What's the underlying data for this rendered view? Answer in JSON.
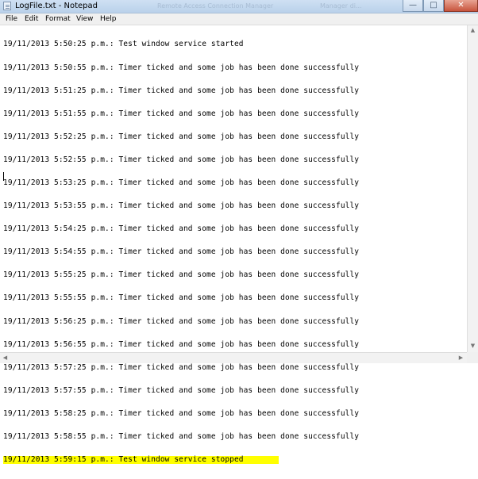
{
  "window": {
    "title": "LogFile.txt - Notepad",
    "background_titles": [
      "Remote Access Connection Manager",
      "Manager di..."
    ],
    "controls": {
      "minimize": "—",
      "maximize": "□",
      "close": "✕"
    }
  },
  "menu": [
    "File",
    "Edit",
    "Format",
    "View",
    "Help"
  ],
  "document": {
    "lines": [
      "19/11/2013 5:50:25 p.m.: Test window service started",
      "19/11/2013 5:50:55 p.m.: Timer ticked and some job has been done successfully",
      "19/11/2013 5:51:25 p.m.: Timer ticked and some job has been done successfully",
      "19/11/2013 5:51:55 p.m.: Timer ticked and some job has been done successfully",
      "19/11/2013 5:52:25 p.m.: Timer ticked and some job has been done successfully",
      "19/11/2013 5:52:55 p.m.: Timer ticked and some job has been done successfully",
      "19/11/2013 5:53:25 p.m.: Timer ticked and some job has been done successfully",
      "19/11/2013 5:53:55 p.m.: Timer ticked and some job has been done successfully",
      "19/11/2013 5:54:25 p.m.: Timer ticked and some job has been done successfully",
      "19/11/2013 5:54:55 p.m.: Timer ticked and some job has been done successfully",
      "19/11/2013 5:55:25 p.m.: Timer ticked and some job has been done successfully",
      "19/11/2013 5:55:55 p.m.: Timer ticked and some job has been done successfully",
      "19/11/2013 5:56:25 p.m.: Timer ticked and some job has been done successfully",
      "19/11/2013 5:56:55 p.m.: Timer ticked and some job has been done successfully",
      "19/11/2013 5:57:25 p.m.: Timer ticked and some job has been done successfully",
      "19/11/2013 5:57:55 p.m.: Timer ticked and some job has been done successfully",
      "19/11/2013 5:58:25 p.m.: Timer ticked and some job has been done successfully",
      "19/11/2013 5:58:55 p.m.: Timer ticked and some job has been done successfully",
      "19/11/2013 5:59:15 p.m.: Test window service stopped"
    ],
    "highlight_color": "#ffff00"
  },
  "scrollbars": {
    "up": "▲",
    "down": "▼",
    "left": "◀",
    "right": "▶"
  },
  "icons": [
    "notepad-icon",
    "minimize-icon",
    "maximize-icon",
    "close-icon"
  ]
}
